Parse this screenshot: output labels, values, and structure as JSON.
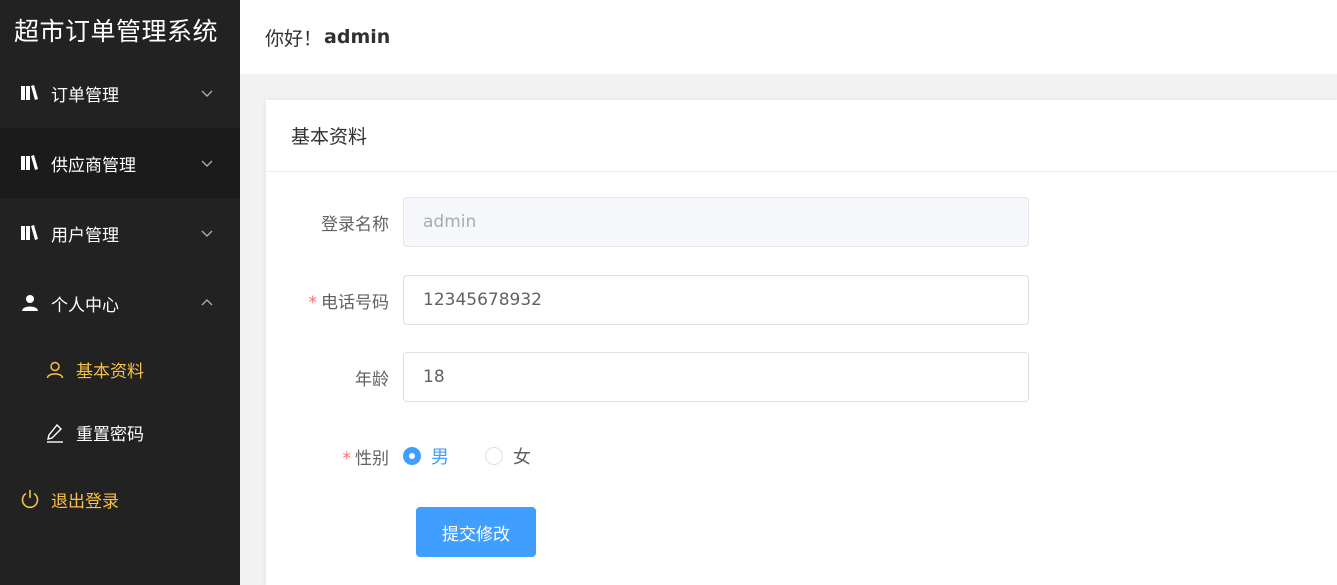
{
  "app": {
    "title": "超市订单管理系统"
  },
  "sidebar": {
    "menus": [
      {
        "label": "订单管理",
        "icon": "book-icon",
        "expanded": false
      },
      {
        "label": "供应商管理",
        "icon": "book-icon",
        "expanded": false
      },
      {
        "label": "用户管理",
        "icon": "book-icon",
        "expanded": false
      },
      {
        "label": "个人中心",
        "icon": "user-icon",
        "expanded": true
      }
    ],
    "submenu": [
      {
        "label": "基本资料",
        "icon": "user-outline-icon",
        "active": true
      },
      {
        "label": "重置密码",
        "icon": "pen-icon",
        "active": false
      }
    ],
    "logout": {
      "label": "退出登录",
      "icon": "power-icon"
    }
  },
  "header": {
    "greeting": "你好！",
    "username": "admin"
  },
  "card": {
    "title": "基本资料"
  },
  "form": {
    "login_name": {
      "label": "登录名称",
      "value": "admin",
      "disabled": true
    },
    "phone": {
      "label": "电话号码",
      "value": "12345678932",
      "required_mark": "*"
    },
    "age": {
      "label": "年龄",
      "value": "18"
    },
    "gender": {
      "label": "性别",
      "required_mark": "*",
      "options": [
        {
          "label": "男",
          "checked": true
        },
        {
          "label": "女",
          "checked": false
        }
      ]
    },
    "submit_label": "提交修改"
  },
  "colors": {
    "sidebar_bg": "#222222",
    "accent_yellow": "#f7c046",
    "primary_blue": "#409eff"
  }
}
